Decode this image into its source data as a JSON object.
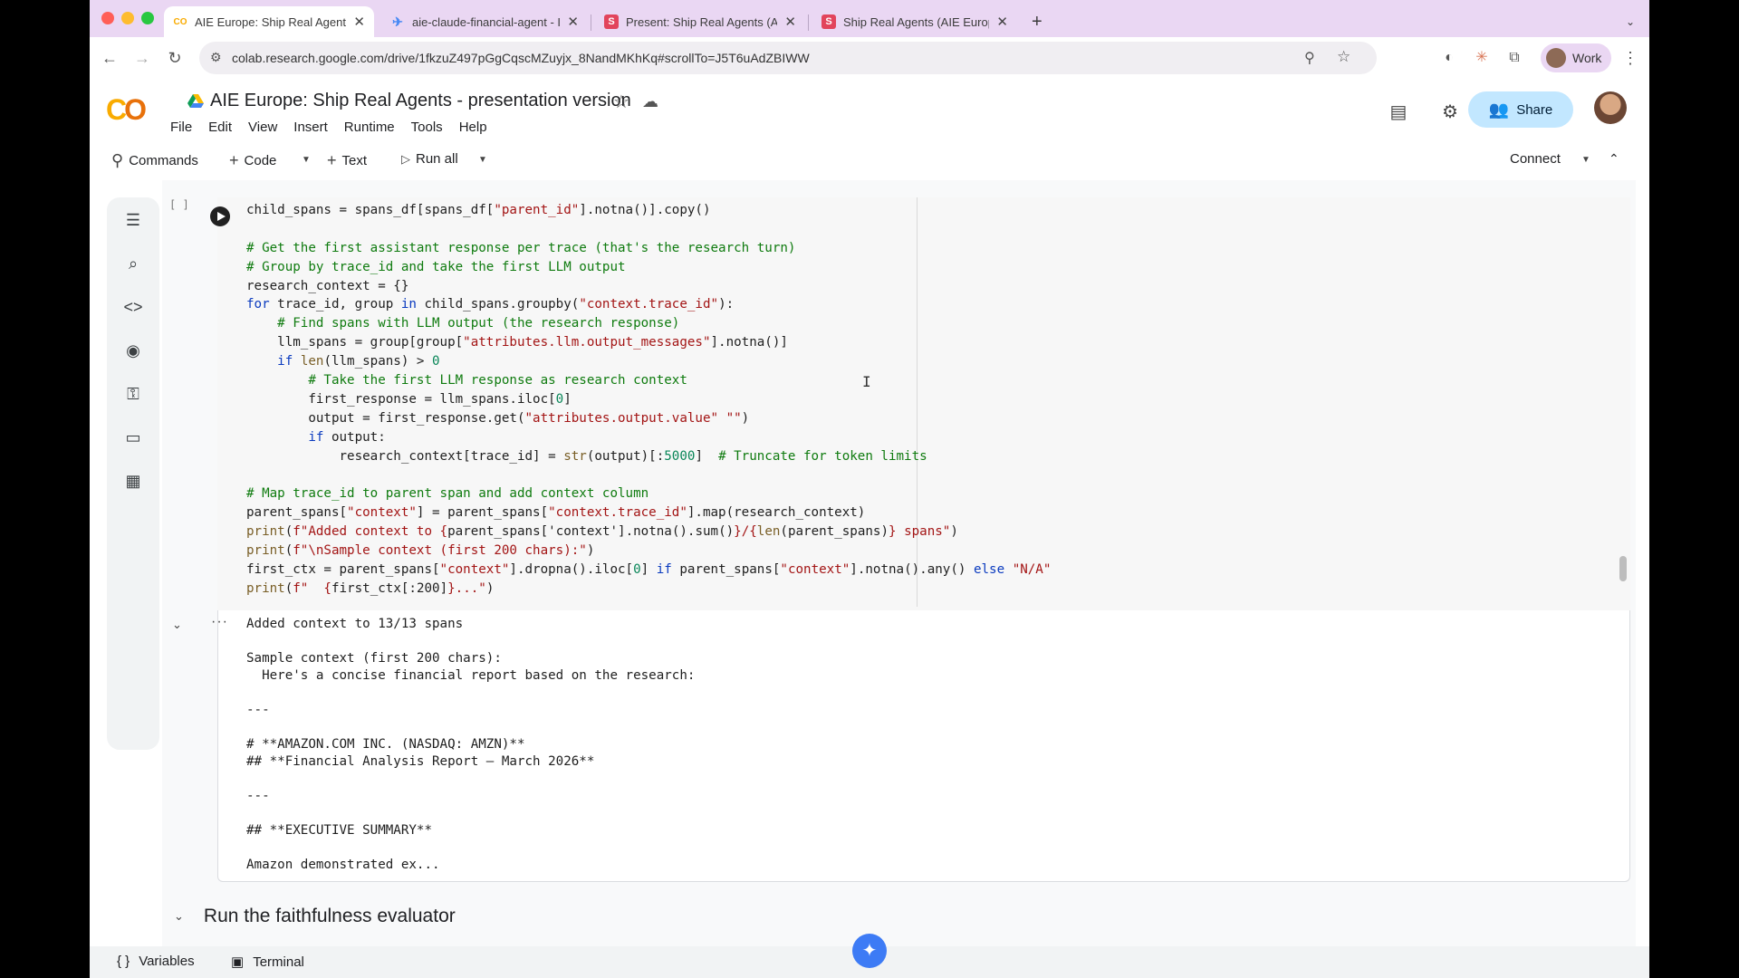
{
  "browser": {
    "tabs": [
      {
        "title": "AIE Europe: Ship Real Agents",
        "favicon": "CO",
        "favicon_color": "#f9ab00",
        "active": true
      },
      {
        "title": "aie-claude-financial-agent - I",
        "favicon": "✈",
        "favicon_color": "#4a8af4",
        "active": false
      },
      {
        "title": "Present: Ship Real Agents (A",
        "favicon": "S",
        "favicon_color": "#e2445c",
        "active": false
      },
      {
        "title": "Ship Real Agents (AIE Europe",
        "favicon": "S",
        "favicon_color": "#e2445c",
        "active": false
      }
    ],
    "new_tab": "+",
    "url": "colab.research.google.com/drive/1fkzuZ497pGgCqscMZuyjx_8NandMKhKq#scrollTo=J5T6uAdZBIWW",
    "profile_label": "Work"
  },
  "notebook": {
    "title": "AIE Europe: Ship Real Agents - presentation version",
    "menu": [
      "File",
      "Edit",
      "View",
      "Insert",
      "Runtime",
      "Tools",
      "Help"
    ],
    "share_label": "Share",
    "toolbar": {
      "commands": "Commands",
      "code": "Code",
      "text": "Text",
      "run_all": "Run all",
      "connect": "Connect"
    },
    "cell_brackets": "[ ]",
    "code_lines": [
      [
        [
          "",
          "child_spans = spans_df[spans_df["
        ],
        [
          "st",
          "\"parent_id\""
        ],
        [
          "",
          "].notna()].copy()"
        ]
      ],
      [],
      [
        [
          "cm",
          "# Get the first assistant response per trace (that's the research turn)"
        ]
      ],
      [
        [
          "cm",
          "# Group by trace_id and take the first LLM output"
        ]
      ],
      [
        [
          "",
          "research_context = {}"
        ]
      ],
      [
        [
          "kw",
          "for"
        ],
        [
          "",
          " trace_id, group "
        ],
        [
          "kw",
          "in"
        ],
        [
          "",
          " child_spans.groupby("
        ],
        [
          "st",
          "\"context.trace_id\""
        ],
        [
          "",
          "):"
        ]
      ],
      [
        [
          "",
          "    "
        ],
        [
          "cm",
          "# Find spans with LLM output (the research response)"
        ]
      ],
      [
        [
          "",
          "    llm_spans = group[group["
        ],
        [
          "st",
          "\"attributes.llm.output_messages\""
        ],
        [
          "",
          "].notna()]"
        ]
      ],
      [
        [
          "",
          "    "
        ],
        [
          "kw",
          "if"
        ],
        [
          "",
          " "
        ],
        [
          "fn",
          "len"
        ],
        [
          "",
          "(llm_spans) > "
        ],
        [
          "num",
          "0"
        ],
        [
          ":"
        ]
      ],
      [
        [
          "",
          "        "
        ],
        [
          "cm",
          "# Take the first LLM response as research context"
        ]
      ],
      [
        [
          "",
          "        first_response = llm_spans.iloc["
        ],
        [
          "num",
          "0"
        ],
        [
          "",
          "]"
        ]
      ],
      [
        [
          "",
          "        output = first_response.get("
        ],
        [
          "st",
          "\"attributes.output.value\""
        ],
        [
          ",",
          ""
        ],
        [
          "st",
          " \"\""
        ],
        [
          "",
          ")"
        ]
      ],
      [
        [
          "",
          "        "
        ],
        [
          "kw",
          "if"
        ],
        [
          "",
          " output:"
        ]
      ],
      [
        [
          "",
          "            research_context[trace_id] = "
        ],
        [
          "fn",
          "str"
        ],
        [
          "",
          "(output)[:"
        ],
        [
          "num",
          "5000"
        ],
        [
          "",
          "]  "
        ],
        [
          "cm",
          "# Truncate for token limits"
        ]
      ],
      [],
      [
        [
          "cm",
          "# Map trace_id to parent span and add context column"
        ]
      ],
      [
        [
          "",
          "parent_spans["
        ],
        [
          "st",
          "\"context\""
        ],
        [
          "",
          "] = parent_spans["
        ],
        [
          "st",
          "\"context.trace_id\""
        ],
        [
          "",
          "].map(research_context)"
        ]
      ],
      [
        [
          "fn",
          "print"
        ],
        [
          "",
          "("
        ],
        [
          "st",
          "f\"Added context to {"
        ],
        [
          "",
          "parent_spans['context'].notna().sum()"
        ],
        [
          "st",
          "}/{"
        ],
        [
          "fn",
          "len"
        ],
        [
          "",
          "(parent_spans)"
        ],
        [
          "st",
          "} spans\""
        ],
        [
          "",
          ")"
        ]
      ],
      [
        [
          "fn",
          "print"
        ],
        [
          "",
          "("
        ],
        [
          "st",
          "f\"\\nSample context (first 200 chars):\""
        ],
        [
          "",
          ")"
        ]
      ],
      [
        [
          "",
          "first_ctx = parent_spans["
        ],
        [
          "st",
          "\"context\""
        ],
        [
          "",
          "].dropna().iloc["
        ],
        [
          "num",
          "0"
        ],
        [
          "",
          "] "
        ],
        [
          "kw",
          "if"
        ],
        [
          "",
          " parent_spans["
        ],
        [
          "st",
          "\"context\""
        ],
        [
          "",
          "].notna().any() "
        ],
        [
          "kw",
          "else"
        ],
        [
          "",
          " "
        ],
        [
          "st",
          "\"N/A\""
        ]
      ],
      [
        [
          "fn",
          "print"
        ],
        [
          "",
          "("
        ],
        [
          "st",
          "f\"  {"
        ],
        [
          "",
          "first_ctx[:200]"
        ],
        [
          "st",
          "}...\""
        ],
        [
          "",
          ")"
        ]
      ]
    ],
    "output_lines": [
      "Added context to 13/13 spans",
      "",
      "Sample context (first 200 chars):",
      "  Here's a concise financial report based on the research:",
      "",
      "---",
      "",
      "# **AMAZON.COM INC. (NASDAQ: AMZN)**",
      "## **Financial Analysis Report – March 2026**",
      "",
      "---",
      "",
      "## **EXECUTIVE SUMMARY**",
      "",
      "Amazon demonstrated ex..."
    ],
    "next_section": "Run the faithfulness evaluator",
    "bottom": {
      "variables": "Variables",
      "terminal": "Terminal"
    }
  },
  "colors": {
    "accent": "#c2e7ff",
    "tabstrip": "#ead7f3"
  }
}
